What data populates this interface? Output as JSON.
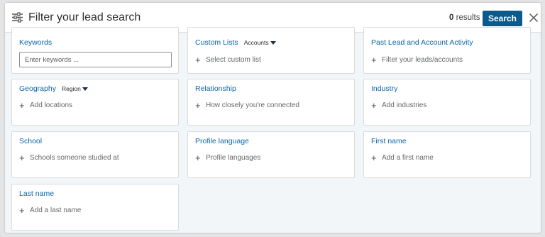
{
  "header": {
    "title": "Filter your lead search",
    "results_count": "0",
    "results_label": "results",
    "search_label": "Search"
  },
  "filters": {
    "keywords": {
      "title": "Keywords",
      "placeholder": "Enter keywords ..."
    },
    "custom_lists": {
      "title": "Custom Lists",
      "dropdown": "Accounts",
      "sub": "Select custom list"
    },
    "past_activity": {
      "title": "Past Lead and Account Activity",
      "sub": "Filter your leads/accounts"
    },
    "geography": {
      "title": "Geography",
      "dropdown": "Region",
      "sub": "Add locations"
    },
    "relationship": {
      "title": "Relationship",
      "sub": "How closely you're connected"
    },
    "industry": {
      "title": "Industry",
      "sub": "Add industries"
    },
    "school": {
      "title": "School",
      "sub": "Schools someone studied at"
    },
    "profile_language": {
      "title": "Profile language",
      "sub": "Profile languages"
    },
    "first_name": {
      "title": "First name",
      "sub": "Add a first name"
    },
    "last_name": {
      "title": "Last name",
      "sub": "Add a last name"
    }
  },
  "colors": {
    "accent": "#0b5a8c",
    "link": "#0a66a8",
    "background": "#f3f6f8"
  },
  "icons": {
    "filter": "sliders-icon",
    "close": "close-icon",
    "add": "plus-icon",
    "dropdown": "caret-down-icon"
  }
}
